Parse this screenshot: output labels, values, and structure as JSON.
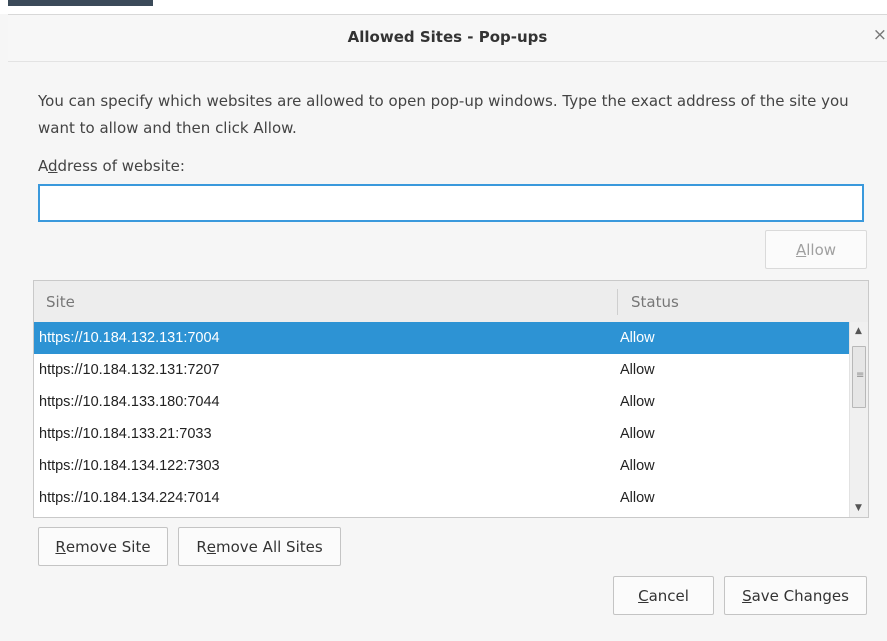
{
  "dialog": {
    "title": "Allowed Sites - Pop-ups",
    "close_glyph": "×",
    "description": "You can specify which websites are allowed to open pop-up windows. Type the exact address of the site you want to allow and then click Allow."
  },
  "address": {
    "label_accesskey": "d",
    "label_before": "A",
    "label_after": "dress of website:",
    "value": ""
  },
  "allow_button": {
    "accesskey": "A",
    "rest": "llow"
  },
  "table": {
    "columns": {
      "site": "Site",
      "status": "Status"
    },
    "rows": [
      {
        "site": "https://10.184.132.131:7004",
        "status": "Allow",
        "selected": true
      },
      {
        "site": "https://10.184.132.131:7207",
        "status": "Allow",
        "selected": false
      },
      {
        "site": "https://10.184.133.180:7044",
        "status": "Allow",
        "selected": false
      },
      {
        "site": "https://10.184.133.21:7033",
        "status": "Allow",
        "selected": false
      },
      {
        "site": "https://10.184.134.122:7303",
        "status": "Allow",
        "selected": false
      },
      {
        "site": "https://10.184.134.224:7014",
        "status": "Allow",
        "selected": false
      }
    ]
  },
  "buttons": {
    "remove_site": {
      "accesskey": "R",
      "rest": "emove Site"
    },
    "remove_all": {
      "before": "R",
      "accesskey": "e",
      "rest": "move All Sites"
    },
    "cancel": {
      "accesskey": "C",
      "rest": "ancel"
    },
    "save": {
      "accesskey": "S",
      "rest": "ave Changes"
    }
  },
  "icons": {
    "close": "close-icon",
    "scroll_up": "triangle-up-icon",
    "scroll_down": "triangle-down-icon"
  },
  "colors": {
    "accent": "#2d93d4",
    "input_border": "#3a99dc"
  }
}
